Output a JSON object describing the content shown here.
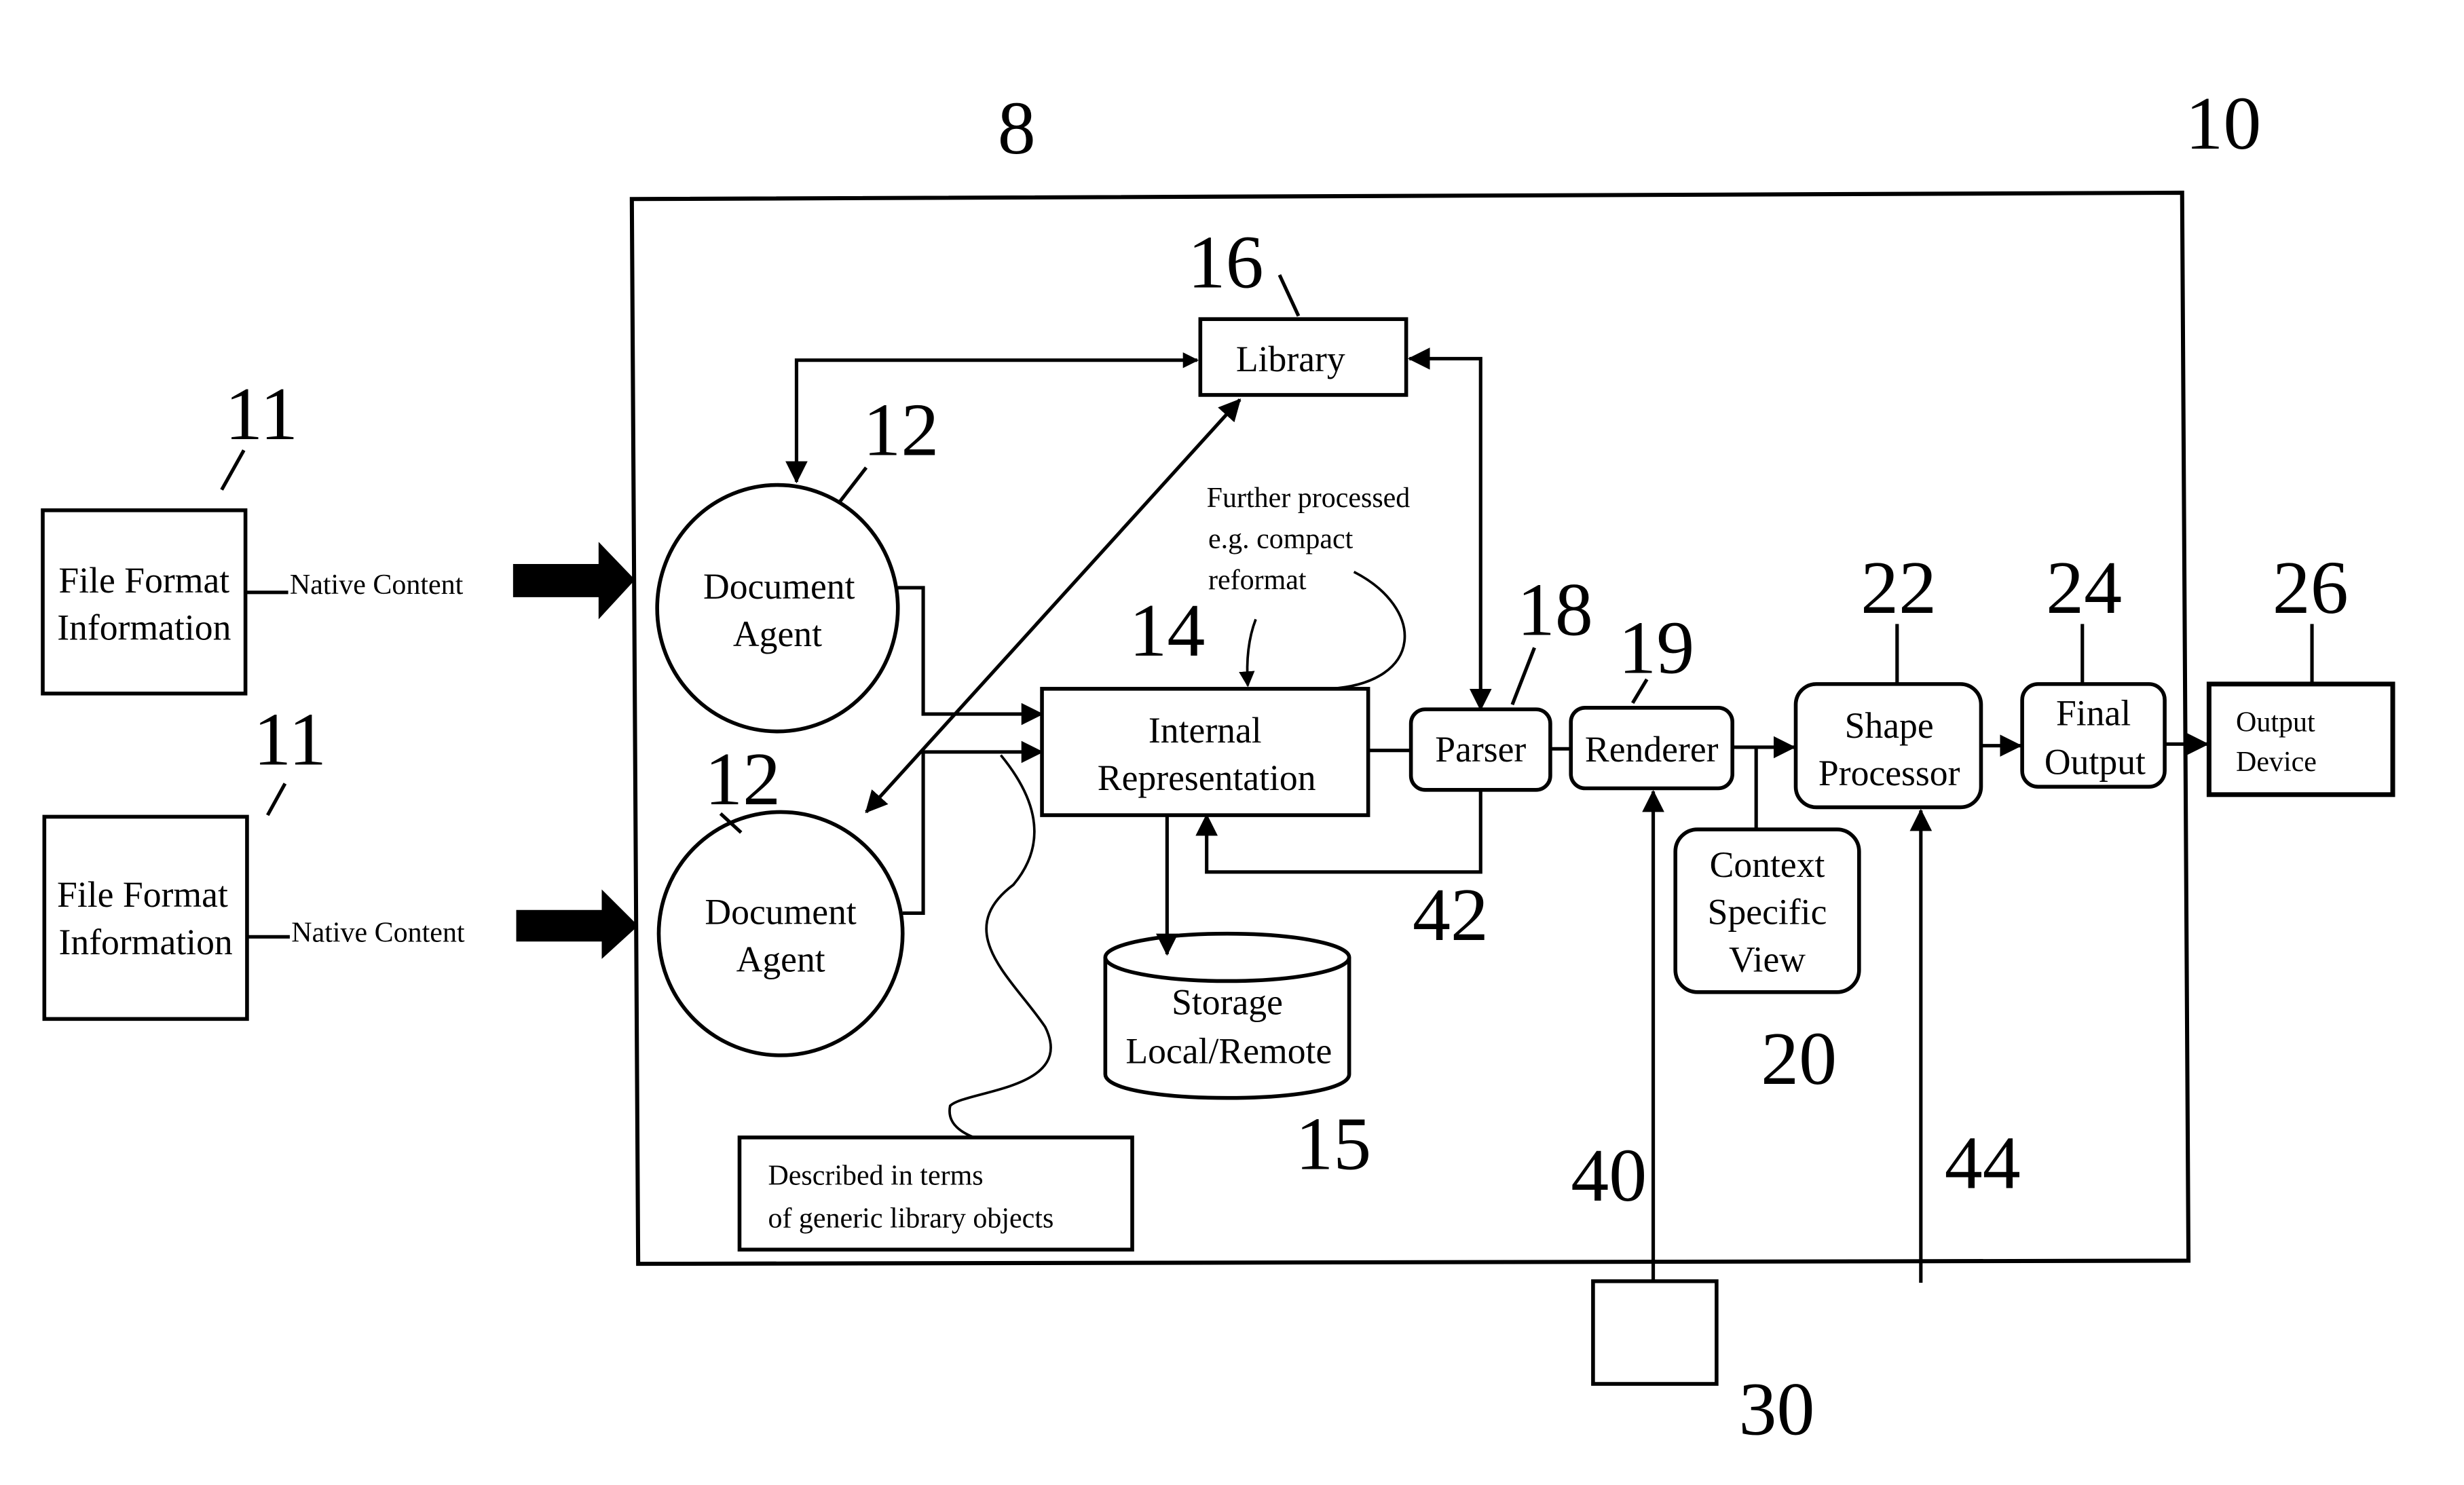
{
  "figure": {
    "ref_system": "8",
    "ref_frame": "10"
  },
  "inputs": [
    {
      "ref": "11",
      "line1": "File Format",
      "line2": "Information",
      "edge_label": "Native Content"
    },
    {
      "ref": "11",
      "line1": "File Format",
      "line2": "Information",
      "edge_label": "Native Content"
    }
  ],
  "agents": [
    {
      "ref": "12",
      "line1": "Document",
      "line2": "Agent"
    },
    {
      "ref": "12",
      "line1": "Document",
      "line2": "Agent"
    }
  ],
  "library": {
    "ref": "16",
    "label": "Library"
  },
  "internal_rep": {
    "ref": "14",
    "line1": "Internal",
    "line2": "Representation"
  },
  "annotation_further": {
    "line1": "Further processed",
    "line2": "e.g. compact",
    "line3": "reformat"
  },
  "annotation_generic": {
    "line1": "Described in terms",
    "line2": "of generic library objects"
  },
  "storage": {
    "ref": "15",
    "line1": "Storage",
    "line2": "Local/Remote"
  },
  "parser": {
    "ref": "18",
    "label": "Parser",
    "feedback_ref": "42"
  },
  "renderer": {
    "ref": "19",
    "label": "Renderer"
  },
  "context_view": {
    "ref": "20",
    "line1": "Context",
    "line2": "Specific",
    "line3": "View"
  },
  "shape_processor": {
    "ref": "22",
    "line1": "Shape",
    "line2": "Processor"
  },
  "final_output": {
    "ref": "24",
    "line1": "Final",
    "line2": "Output"
  },
  "output_device": {
    "ref": "26",
    "line1": "Output",
    "line2": "Device"
  },
  "control": {
    "ref": "30",
    "renderer_input_ref": "40",
    "shape_input_ref": "44"
  }
}
